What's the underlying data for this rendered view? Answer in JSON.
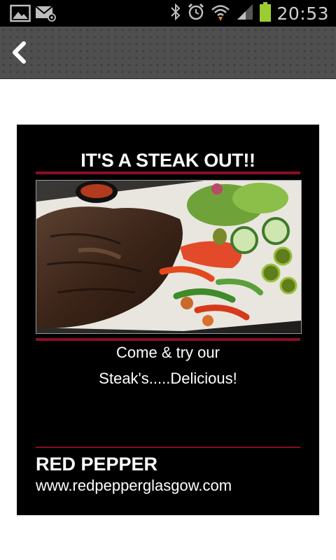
{
  "status_bar": {
    "time": "20:53",
    "icons": [
      "gallery-icon",
      "email-icon",
      "bluetooth-icon",
      "alarm-icon",
      "wifi-icon",
      "signal-icon",
      "battery-icon"
    ]
  },
  "action_bar": {
    "back_icon": "chevron-left-icon"
  },
  "poster": {
    "headline": "IT'S A STEAK OUT!!",
    "photo_description_icon": "steak-plate-photo",
    "tagline_line1": "Come & try our",
    "tagline_line2": "Steak's.....Delicious!",
    "brand": "RED PEPPER",
    "url": "www.redpepperglasgow.com"
  },
  "colors": {
    "accent_red": "#8b0d22",
    "battery_green": "#9acd32",
    "poster_bg": "#000000"
  }
}
